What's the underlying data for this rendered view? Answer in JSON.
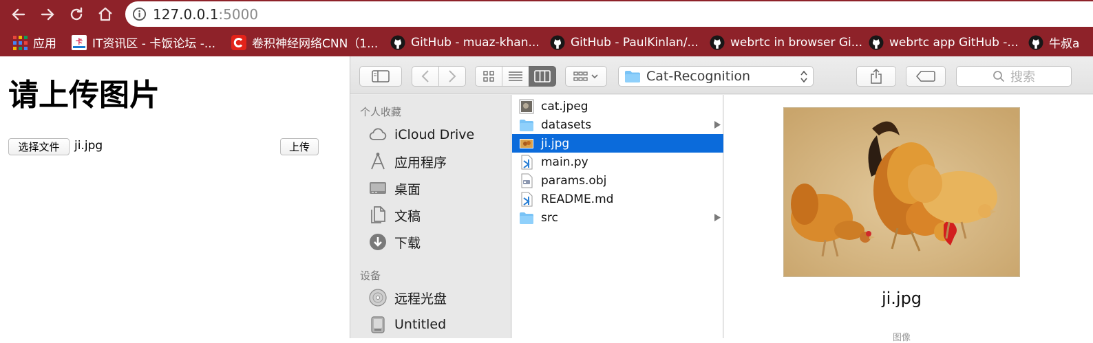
{
  "browser": {
    "address": {
      "host": "127.0.0.1",
      "port": ":5000"
    },
    "colors": {
      "chrome": "#8e2229"
    },
    "nav_icons": [
      "back-icon",
      "forward-icon",
      "reload-icon",
      "home-icon"
    ]
  },
  "bookmarks": [
    {
      "label": "应用",
      "icon": "apps-grid-icon"
    },
    {
      "label": "IT资讯区 - 卡饭论坛 -...",
      "icon": "kafan-icon"
    },
    {
      "label": "卷积神经网络CNN（1...",
      "icon": "csdn-icon"
    },
    {
      "label": "GitHub - muaz-khan...",
      "icon": "github-icon"
    },
    {
      "label": "GitHub - PaulKinlan/...",
      "icon": "github-icon"
    },
    {
      "label": "webrtc in browser Gi...",
      "icon": "github-icon"
    },
    {
      "label": "webrtc app GitHub -...",
      "icon": "github-icon"
    },
    {
      "label": "牛叔a",
      "icon": "github-icon"
    }
  ],
  "page": {
    "title": "请上传图片",
    "choose_file_label": "选择文件",
    "chosen_file": "ji.jpg",
    "upload_label": "上传"
  },
  "dialog": {
    "location": "Cat-Recognition",
    "search_placeholder": "搜索",
    "sidebar": {
      "favorites_heading": "个人收藏",
      "favorites": [
        "iCloud Drive",
        "应用程序",
        "桌面",
        "文稿",
        "下载"
      ],
      "devices_heading": "设备",
      "devices": [
        "远程光盘",
        "Untitled"
      ]
    },
    "files": [
      {
        "name": "cat.jpeg",
        "kind": "image",
        "folder": false,
        "selected": false
      },
      {
        "name": "datasets",
        "kind": "folder",
        "folder": true,
        "selected": false
      },
      {
        "name": "ji.jpg",
        "kind": "image",
        "folder": false,
        "selected": true
      },
      {
        "name": "main.py",
        "kind": "code",
        "folder": false,
        "selected": false
      },
      {
        "name": "params.obj",
        "kind": "object",
        "folder": false,
        "selected": false
      },
      {
        "name": "README.md",
        "kind": "code",
        "folder": false,
        "selected": false
      },
      {
        "name": "src",
        "kind": "folder",
        "folder": true,
        "selected": false
      }
    ],
    "preview": {
      "name": "ji.jpg",
      "kind_label": "图像"
    },
    "colors": {
      "selection": "#0b6bdb",
      "folder": "#79c3f6"
    }
  }
}
